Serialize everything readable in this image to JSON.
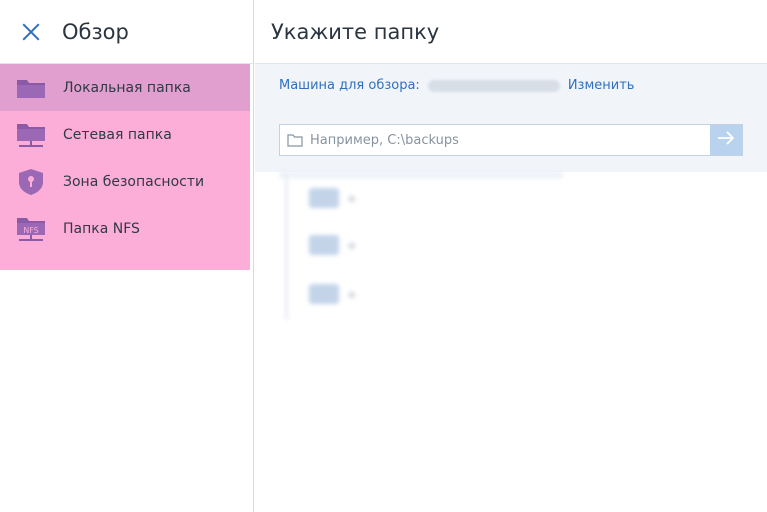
{
  "left": {
    "title": "Обзор",
    "items": [
      {
        "label": "Локальная папка",
        "icon": "folder-icon",
        "selected": true
      },
      {
        "label": "Сетевая папка",
        "icon": "network-folder-icon",
        "selected": false
      },
      {
        "label": "Зона безопасности",
        "icon": "shield-lock-icon",
        "selected": false
      },
      {
        "label": "Папка NFS",
        "icon": "nfs-folder-icon",
        "selected": false,
        "badge": "NFS"
      }
    ]
  },
  "right": {
    "title": "Укажите папку",
    "machine_label": "Машина для обзора:",
    "change_link": "Изменить",
    "path_placeholder": "Например, C:\\backups",
    "path_value": ""
  },
  "colors": {
    "accent": "#2f6fbf",
    "menu_bg": "#fdaed8",
    "menu_selected": "#e19fcf",
    "icon_purple": "#8a5aa6"
  }
}
